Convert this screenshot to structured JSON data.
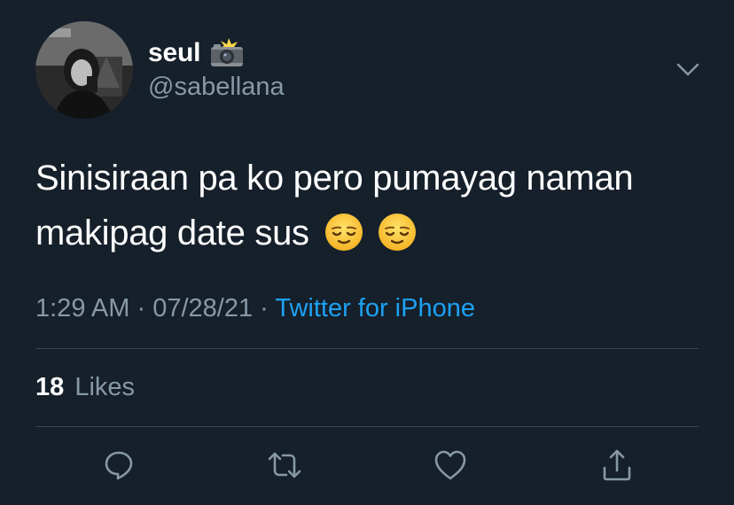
{
  "header": {
    "display_name": "seul",
    "name_emoji": "camera-with-flash-emoji",
    "handle": "@sabellana",
    "menu_icon": "chevron-down-icon"
  },
  "tweet": {
    "line1": "Sinisiraan pa ko pero pumayag naman",
    "line2": "makipag date sus",
    "emojis": [
      "relieved-face-emoji",
      "relieved-face-emoji"
    ]
  },
  "meta": {
    "time": "1:29 AM",
    "separator": " · ",
    "date": "07/28/21",
    "source": "Twitter for iPhone"
  },
  "stats": {
    "likes_count": "18",
    "likes_label": "Likes"
  },
  "actions": {
    "reply_icon": "reply-icon",
    "retweet_icon": "retweet-icon",
    "like_icon": "like-icon",
    "share_icon": "share-icon"
  },
  "colors": {
    "background": "#15202b",
    "primary_text": "#ffffff",
    "secondary_text": "#8899a6",
    "link": "#1da1f2",
    "divider": "#38444d"
  }
}
